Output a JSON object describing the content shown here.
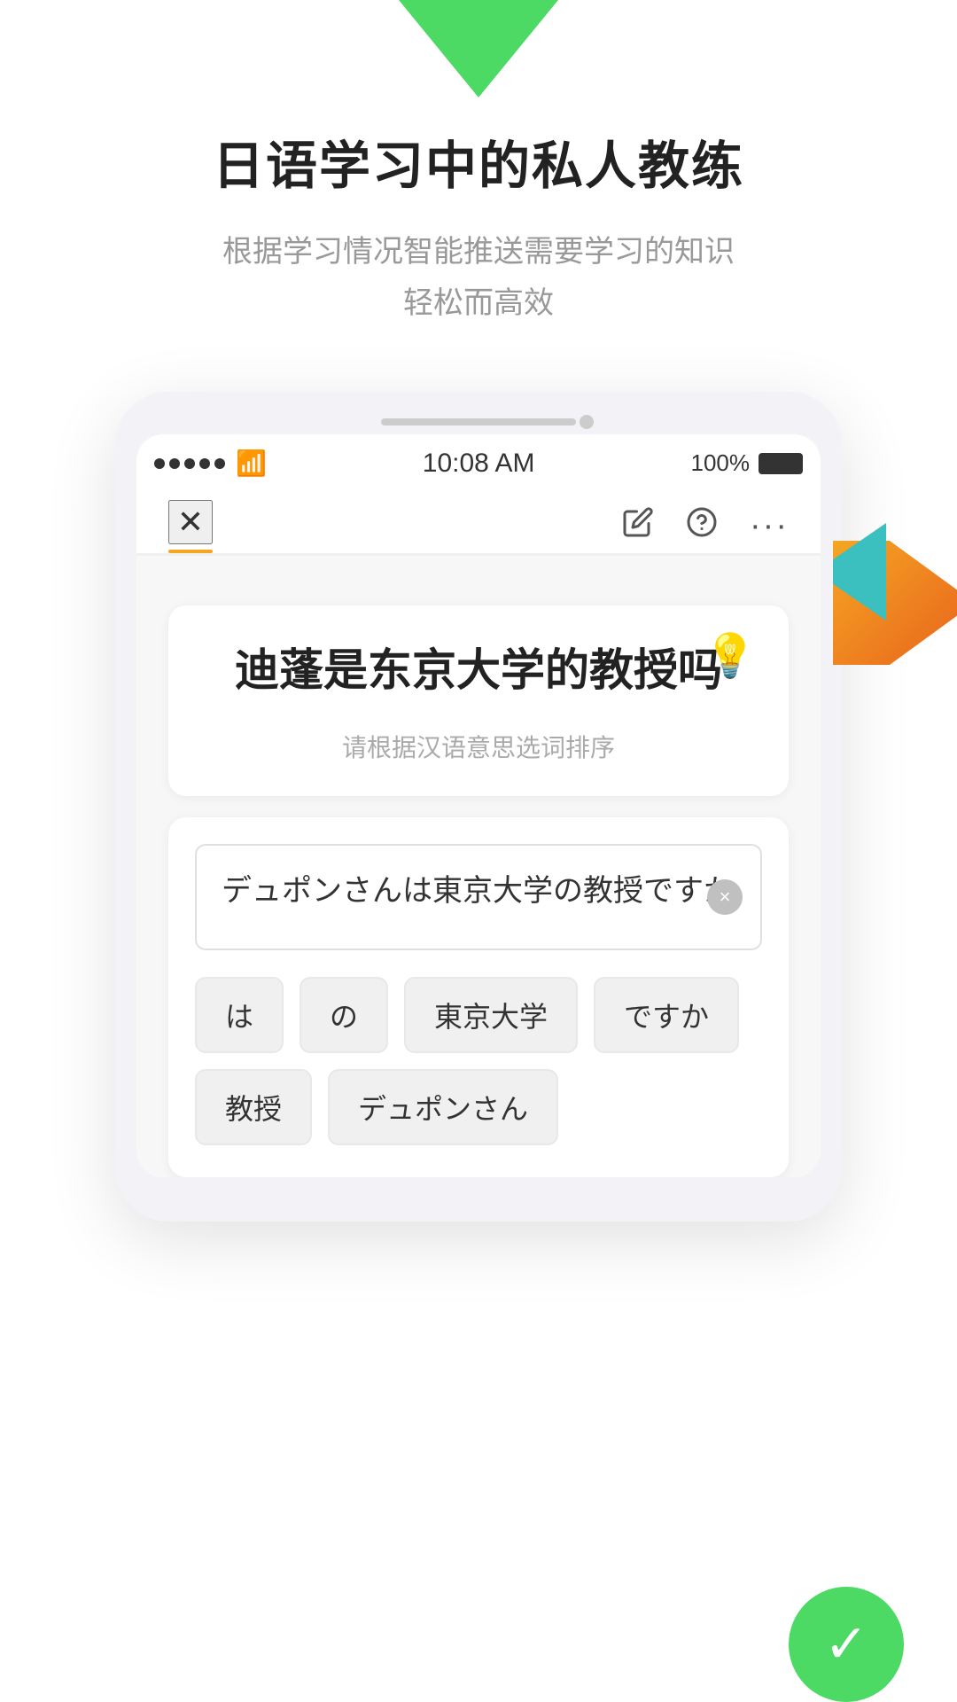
{
  "page": {
    "main_title": "日语学习中的私人教练",
    "sub_title_line1": "根据学习情况智能推送需要学习的知识",
    "sub_title_line2": "轻松而高效"
  },
  "status_bar": {
    "time": "10:08 AM",
    "battery": "100%",
    "signal_dots": 5
  },
  "navbar": {
    "close_label": "✕",
    "icons": [
      "✏️",
      "❓",
      "···"
    ]
  },
  "lesson_card": {
    "question": "迪蓬是东京大学的教授吗",
    "instruction": "请根据汉语意思选词排序",
    "hint_icon": "💡"
  },
  "answer_area": {
    "input_text": "デュポンさんは東京大学の教授ですか",
    "clear_btn": "×"
  },
  "word_chips": {
    "row1": [
      "は",
      "の",
      "東京大学",
      "ですか"
    ],
    "row2": [
      "教授",
      "デュポンさん"
    ]
  },
  "bottom_button": {
    "icon": "✓"
  },
  "colors": {
    "green": "#4cd964",
    "orange": "#f5a623",
    "teal": "#3bbfbf",
    "text_dark": "#222222",
    "text_gray": "#999999",
    "nav_underline": "#f5a623"
  }
}
